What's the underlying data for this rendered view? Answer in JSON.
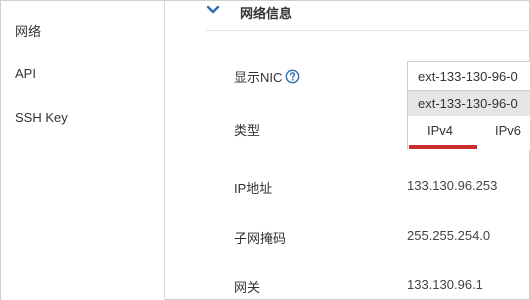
{
  "sidebar": {
    "items": [
      {
        "label": "网络"
      },
      {
        "label": "API"
      },
      {
        "label": "SSH Key"
      }
    ]
  },
  "section": {
    "title": "网络信息",
    "icon": "chevron-down-icon"
  },
  "network": {
    "nic_label": "显示NIC",
    "nic_help_icon": "help-icon",
    "nic_selected": "ext-133-130-96-0",
    "nic_option": "ext-133-130-96-0",
    "type_label": "类型",
    "tabs": [
      {
        "label": "IPv4",
        "active": true
      },
      {
        "label": "IPv6",
        "active": false
      }
    ],
    "ip_label": "IP地址",
    "ip_value": "133.130.96.253",
    "mask_label": "子网掩码",
    "mask_value": "255.255.254.0",
    "gateway_label": "网关",
    "gateway_value": "133.130.96.1"
  },
  "colors": {
    "accent_blue": "#2a6fb5",
    "active_tab_red": "#c9302c",
    "option_gray": "#e6e6e6"
  }
}
